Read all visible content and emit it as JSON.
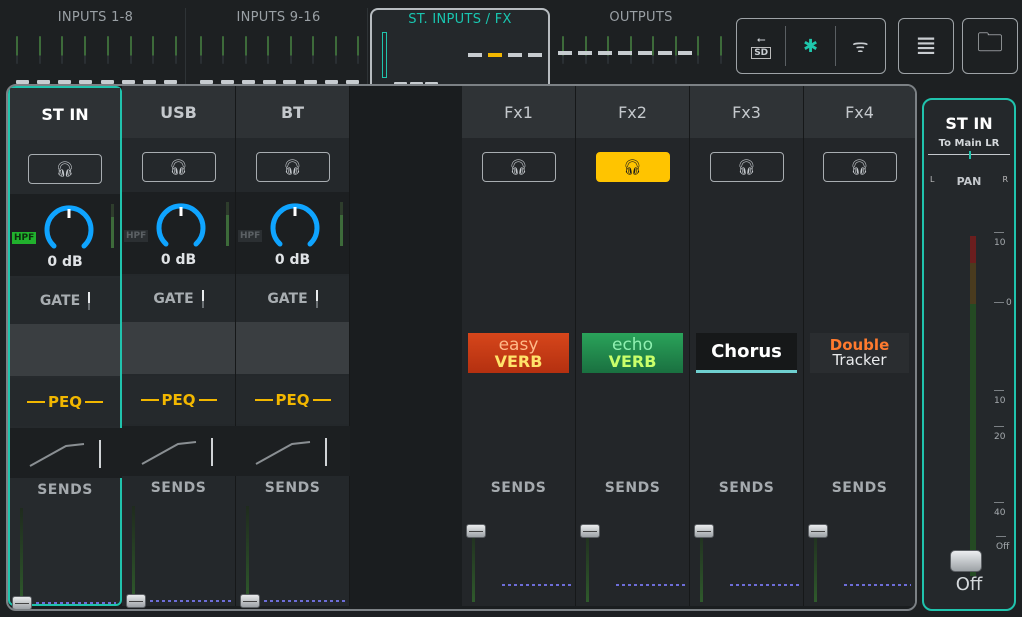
{
  "banks": [
    {
      "label": "INPUTS 1-8"
    },
    {
      "label": "INPUTS 9-16"
    },
    {
      "label": "ST. INPUTS / FX",
      "active": true
    },
    {
      "label": "OUTPUTS"
    }
  ],
  "toolbar": {
    "usb_icon": "⭠",
    "sd_icon": "SD",
    "bluetooth_icon": "✱",
    "wifi_icon": "ᯤ",
    "menu_icon": "≣",
    "folder_icon": "🗀"
  },
  "channels": [
    {
      "name": "ST IN",
      "gain": "0 dB",
      "hpf": "HPF",
      "gate": "GATE",
      "peq": "PEQ",
      "sends": "SENDS",
      "selected": true,
      "hpf_on": true
    },
    {
      "name": "USB",
      "gain": "0 dB",
      "hpf": "HPF",
      "gate": "GATE",
      "peq": "PEQ",
      "sends": "SENDS"
    },
    {
      "name": "BT",
      "gain": "0 dB",
      "hpf": "HPF",
      "gate": "GATE",
      "peq": "PEQ",
      "sends": "SENDS"
    }
  ],
  "fx": [
    {
      "name": "Fx1",
      "sends": "SENDS",
      "logo_a": "easy",
      "logo_b": "VERB"
    },
    {
      "name": "Fx2",
      "sends": "SENDS",
      "logo_a": "echo",
      "logo_b": "VERB",
      "headphone_on": true
    },
    {
      "name": "Fx3",
      "sends": "SENDS",
      "logo_a": "Chorus"
    },
    {
      "name": "Fx4",
      "sends": "SENDS",
      "logo_a": "Double",
      "logo_b": "Tracker"
    }
  ],
  "master": {
    "name": "ST IN",
    "sub": "To Main LR",
    "pan": "PAN",
    "pan_l": "L",
    "pan_r": "R",
    "scale": [
      "10",
      "0",
      "10",
      "20",
      "40",
      "Off"
    ],
    "value": "Off"
  },
  "colors": {
    "accent": "#20c3ad",
    "peq": "#f2b700",
    "hp_on": "#ffc400"
  }
}
